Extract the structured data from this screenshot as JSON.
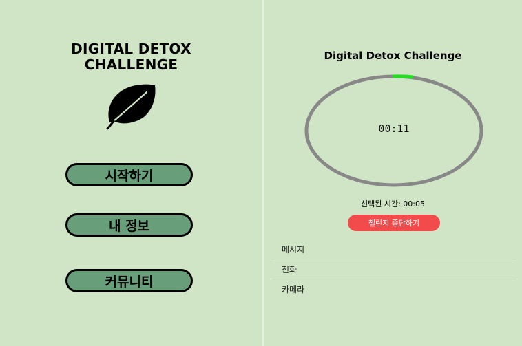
{
  "left_screen": {
    "title_line1": "DIGITAL DETOX",
    "title_line2": "CHALLENGE",
    "icon": "leaf-icon",
    "buttons": {
      "start": "시작하기",
      "profile": "내 정보",
      "community": "커뮤니티"
    }
  },
  "right_screen": {
    "title": "Digital Detox Challenge",
    "timer": {
      "display": "00:11",
      "progress_color": "#22dd22",
      "track_color": "#888888"
    },
    "selected_time": "선택된 시간: 00:05",
    "stop_button": "챌린지 중단하기",
    "app_list": [
      "메시지",
      "전화",
      "카메라"
    ]
  },
  "colors": {
    "background": "#cfe5c5",
    "button_fill": "#689e79",
    "stop_button": "#f24b4b"
  }
}
